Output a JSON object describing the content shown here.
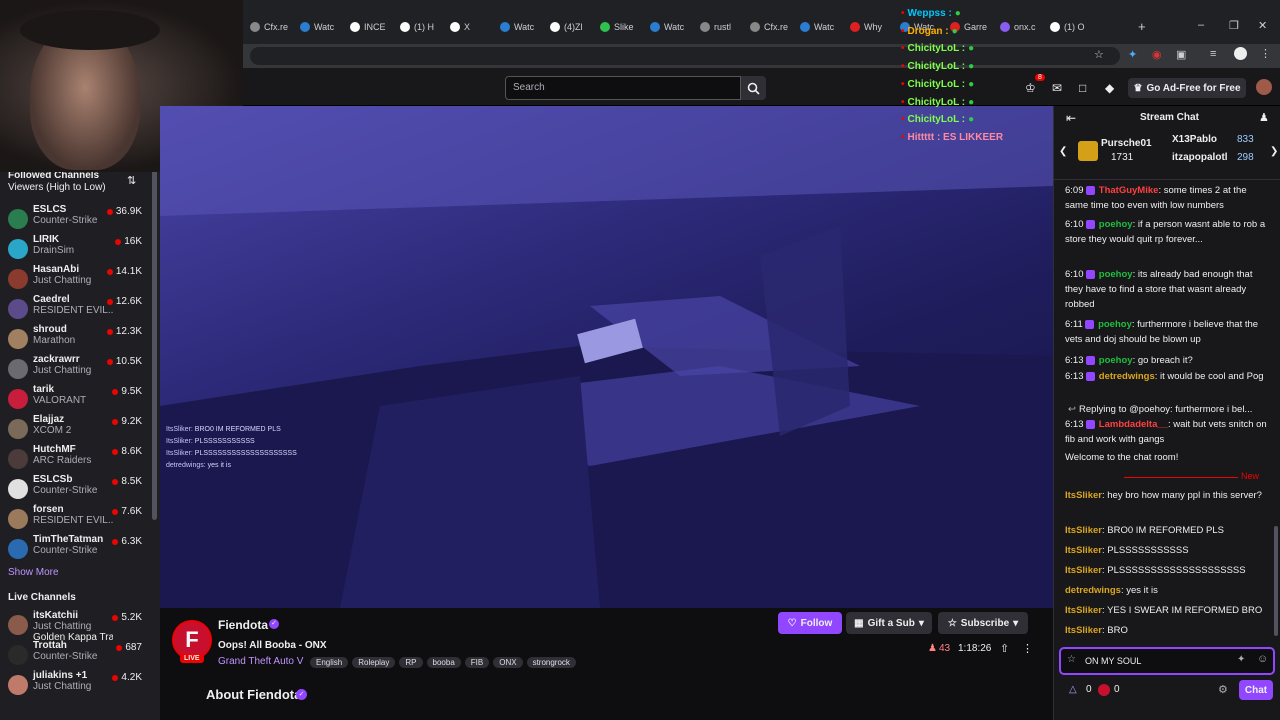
{
  "browser": {
    "tabs": [
      "Cfx.re",
      "Watc",
      "INCE",
      "(1) H",
      "X",
      "Watc",
      "(4)Zl",
      "Slike",
      "Watc",
      "rustl",
      "Cfx.re",
      "Watc",
      "Why",
      "Watc",
      "Garre",
      "onx.c",
      "(1) O"
    ],
    "new_tab": "+"
  },
  "header": {
    "search_placeholder": "Search",
    "notif_count": "8",
    "ad_free": "Go Ad-Free for Free"
  },
  "overlay": {
    "lines": [
      {
        "name": "Weppss :",
        "color": "#00c8ff"
      },
      {
        "name": "Drogan :",
        "color": "#ffb000"
      },
      {
        "name": "ChicityLoL :",
        "color": "#7fff4a"
      },
      {
        "name": "ChicityLoL :",
        "color": "#7fff4a"
      },
      {
        "name": "ChicityLoL :",
        "color": "#7fff4a"
      },
      {
        "name": "ChicityLoL :",
        "color": "#7fff4a"
      },
      {
        "name": "ChicityLoL :",
        "color": "#7fff4a"
      },
      {
        "name": "Hittttt : ES LIKKEER",
        "color": "#ff8aa0"
      }
    ]
  },
  "sidebar": {
    "followed_title": "Followed Channels",
    "sort_label": "Viewers (High to Low)",
    "followed": [
      {
        "name": "ESLCS",
        "game": "Counter-Strike",
        "viewers": "36.9K",
        "color": "#2a7d4f"
      },
      {
        "name": "LIRIK",
        "game": "DrainSim",
        "viewers": "16K",
        "color": "#2aa6c9"
      },
      {
        "name": "HasanAbi",
        "game": "Just Chatting",
        "viewers": "14.1K",
        "color": "#8a3b2d"
      },
      {
        "name": "Caedrel",
        "game": "RESIDENT EVIL...",
        "viewers": "12.6K",
        "color": "#5c4b8a"
      },
      {
        "name": "shroud",
        "game": "Marathon",
        "viewers": "12.3K",
        "color": "#a08060"
      },
      {
        "name": "zackrawrr",
        "game": "Just Chatting",
        "viewers": "10.5K",
        "color": "#6a6a70"
      },
      {
        "name": "tarik",
        "game": "VALORANT",
        "viewers": "9.5K",
        "color": "#c81e3c"
      },
      {
        "name": "Elajjaz",
        "game": "XCOM 2",
        "viewers": "9.2K",
        "color": "#7a6a5a"
      },
      {
        "name": "HutchMF",
        "game": "ARC Raiders",
        "viewers": "8.6K",
        "color": "#4b3b3b"
      },
      {
        "name": "ESLCSb",
        "game": "Counter-Strike",
        "viewers": "8.5K",
        "color": "#e0e0e0"
      },
      {
        "name": "forsen",
        "game": "RESIDENT EVIL...",
        "viewers": "7.6K",
        "color": "#9a7a5a"
      },
      {
        "name": "TimTheTatman",
        "game": "Counter-Strike",
        "viewers": "6.3K",
        "color": "#2a6ab0"
      }
    ],
    "show_more": "Show More",
    "live_title": "Live Channels",
    "live": [
      {
        "name": "itsKatchii",
        "game": "Just Chatting",
        "extra": "Golden Kappa Train",
        "viewers": "5.2K",
        "color": "#8a5a4a"
      },
      {
        "name": "Trottah",
        "game": "Counter-Strike",
        "viewers": "687",
        "color": "#2a2a2a"
      },
      {
        "name": "juliakins +1",
        "game": "Just Chatting",
        "viewers": "4.2K",
        "color": "#c07a6a"
      }
    ]
  },
  "video_chat": [
    {
      "user": "ItsSliker:",
      "text": "BRO0 IM REFORMED PLS"
    },
    {
      "user": "ItsSliker:",
      "text": "PLSSSSSSSSSSS"
    },
    {
      "user": "ItsSliker:",
      "text": "PLSSSSSSSSSSSSSSSSSSSS"
    },
    {
      "user": "detredwings:",
      "text": "yes it is"
    }
  ],
  "stream": {
    "streamer": "Fiendota",
    "title": "Oops! All Booba - ONX",
    "category": "Grand Theft Auto V",
    "tags": [
      "English",
      "Roleplay",
      "RP",
      "booba",
      "FIB",
      "ONX",
      "strongrock"
    ],
    "live_label": "LIVE",
    "follow": "Follow",
    "gift": "Gift a Sub",
    "subscribe": "Subscribe",
    "viewers": "43",
    "uptime": "1:18:26",
    "about": "About Fiendota"
  },
  "chat": {
    "title": "Stream Chat",
    "gifters": [
      {
        "name": "Pursche01",
        "count": "1731"
      },
      {
        "name": "X13Pablo",
        "count": "833"
      },
      {
        "name": "itzapopalotl",
        "count": "298"
      }
    ],
    "messages": [
      {
        "time": "6:09",
        "user": "ThatGuyMike",
        "color": "#ff4040",
        "text": ": some times 2 at the same time too even with low numbers"
      },
      {
        "time": "6:10",
        "user": "poehoy",
        "color": "#1fbf3f",
        "text": ": if a person wasnt able to rob a store they would quit rp forever..."
      },
      {
        "time": "6:10",
        "user": "poehoy",
        "color": "#1fbf3f",
        "text": ": its already bad enough that they have to find a store that wasnt already robbed"
      },
      {
        "time": "6:11",
        "user": "poehoy",
        "color": "#1fbf3f",
        "text": ": furthermore i believe that the vets and doj should be blown up"
      },
      {
        "time": "6:13",
        "user": "poehoy",
        "color": "#1fbf3f",
        "text": ": go breach it?"
      },
      {
        "time": "6:13",
        "user": "detredwings",
        "color": "#daa520",
        "text": ": it would be cool and Pog"
      }
    ],
    "reply_line": "Replying to @poehoy: furthermore i bel...",
    "reply_msg": {
      "time": "6:13",
      "user": "Lambdadelta__",
      "color": "#ff4040",
      "text": ": wait but vets snitch on fib and work with gangs"
    },
    "welcome": "Welcome to the chat room!",
    "new_label": "New",
    "recent": [
      {
        "user": "ItsSliker",
        "color": "#daa520",
        "text": ": hey bro how many ppl in this server?"
      },
      {
        "user": "ItsSliker",
        "color": "#daa520",
        "text": ": BRO0 IM REFORMED PLS"
      },
      {
        "user": "ItsSliker",
        "color": "#daa520",
        "text": ": PLSSSSSSSSSSS"
      },
      {
        "user": "ItsSliker",
        "color": "#daa520",
        "text": ": PLSSSSSSSSSSSSSSSSSSSS"
      },
      {
        "user": "detredwings",
        "color": "#daa520",
        "text": ": yes it is"
      },
      {
        "user": "ItsSliker",
        "color": "#daa520",
        "text": ": YES I SWEAR IM REFORMED BRO"
      },
      {
        "user": "ItsSliker",
        "color": "#daa520",
        "text": ": BRO"
      }
    ],
    "input_value": "ON MY SOUL",
    "points_1": "0",
    "points_2": "0",
    "chat_button": "Chat"
  },
  "colors": {
    "accent": "#9147ff",
    "live": "#eb0400"
  }
}
